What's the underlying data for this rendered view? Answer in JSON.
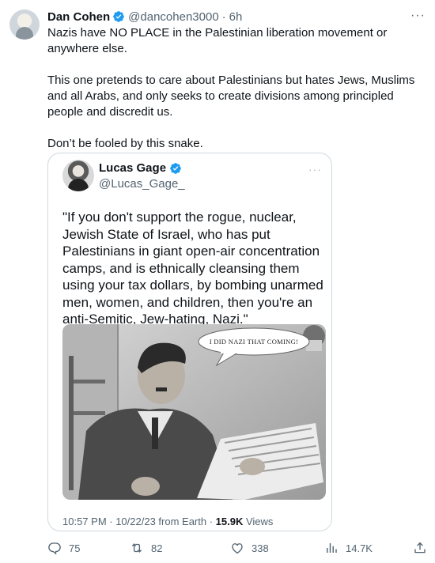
{
  "tweet": {
    "display_name": "Dan Cohen",
    "handle": "@dancohen3000",
    "separator": "·",
    "time": "6h",
    "more": "···",
    "paragraphs": [
      "Nazis have NO PLACE in the Palestinian liberation movement or anywhere else.",
      "This one pretends to care about Palestinians but hates Jews, Muslims and all Arabs, and only seeks to create divisions among principled people and discredit us.",
      "Don’t be fooled by this snake."
    ]
  },
  "quote": {
    "display_name": "Lucas Gage",
    "handle": "@Lucas_Gage_",
    "more": "···",
    "text": "\"If you don't support the rogue, nuclear, Jewish State of Israel, who has put Palestinians in giant open-air concentration camps, and is ethnically cleansing them using your tax dollars, by bombing unarmed men, women, and children, then you're an anti-Semitic, Jew-hating, Nazi.\"",
    "image_caption": "I DID NAZI THAT COMING!",
    "timestamp": "10:57 PM · 10/22/23 from Earth · ",
    "views_count": "15.9K",
    "views_label": " Views"
  },
  "actions": {
    "replies": "75",
    "reposts": "82",
    "likes": "338",
    "views": "14.7K"
  },
  "colors": {
    "text_primary": "#0f1419",
    "text_secondary": "#536471",
    "verified_blue": "#1d9bf0",
    "border": "#cfd9de"
  },
  "icons": [
    "verified-badge-icon",
    "more-icon",
    "reply-icon",
    "repost-icon",
    "like-icon",
    "views-icon",
    "share-icon"
  ]
}
